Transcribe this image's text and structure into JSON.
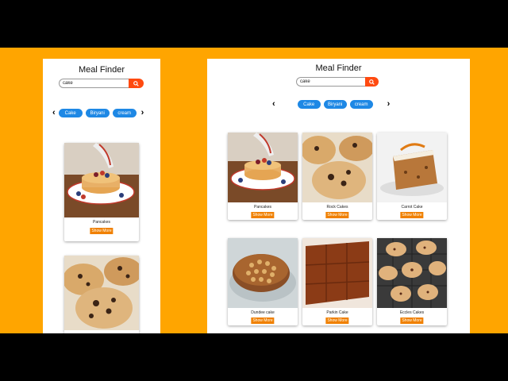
{
  "app": {
    "title": "Meal Finder"
  },
  "search": {
    "value": "cake"
  },
  "categories": [
    "Cake",
    "Biryani",
    "cream"
  ],
  "icons": {
    "search": "search-icon",
    "prev": "chevron-left-icon",
    "next": "chevron-right-icon"
  },
  "colors": {
    "background": "#ffa500",
    "search_button": "#ff4a10",
    "chip": "#1e88e5",
    "show_more": "#f08000"
  },
  "meals": [
    {
      "name": "Pancakes",
      "action": "Show More"
    },
    {
      "name": "Rock Cakes",
      "action": "Show More"
    },
    {
      "name": "Carrot Cake",
      "action": "Show More"
    },
    {
      "name": "Dundee cake",
      "action": "Show More"
    },
    {
      "name": "Parkin Cake",
      "action": "Show More"
    },
    {
      "name": "Eccles Cakes",
      "action": "Show More"
    }
  ]
}
